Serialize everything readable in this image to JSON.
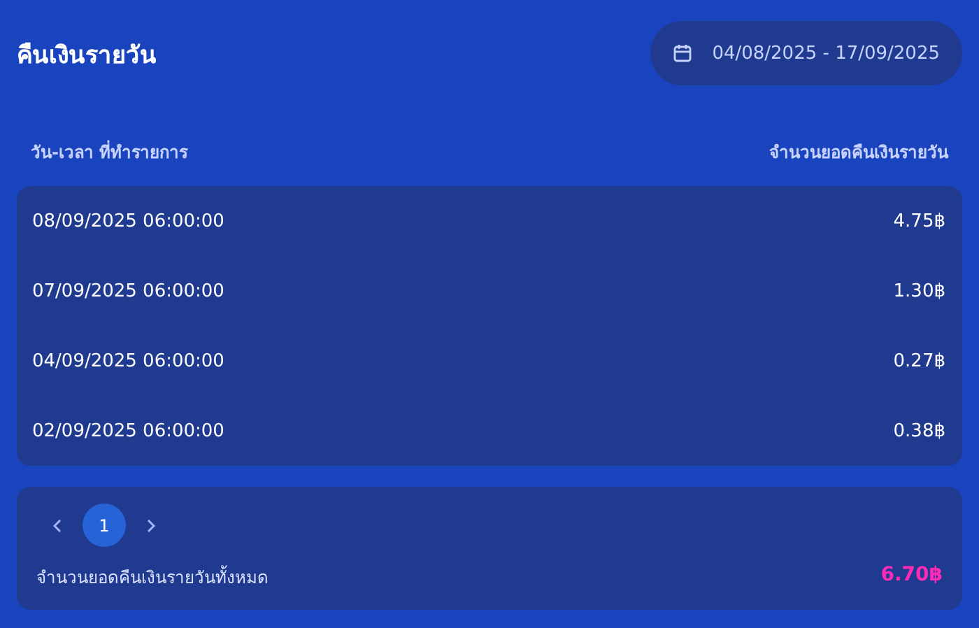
{
  "title": "คืนเงินรายวัน",
  "date_range": "04/08/2025 - 17/09/2025",
  "table": {
    "columns": [
      "วัน-เวลา ที่ทำรายการ",
      "จำนวนยอดคืนเงินรายวัน"
    ],
    "rows": [
      {
        "datetime": "08/09/2025 06:00:00",
        "amount": "4.75฿"
      },
      {
        "datetime": "07/09/2025 06:00:00",
        "amount": "1.30฿"
      },
      {
        "datetime": "04/09/2025 06:00:00",
        "amount": "0.27฿"
      },
      {
        "datetime": "02/09/2025 06:00:00",
        "amount": "0.38฿"
      }
    ]
  },
  "pagination": {
    "pages": [
      {
        "label": "1",
        "selected": true
      }
    ]
  },
  "total": {
    "label": "จำนวนยอดคืนเงินรายวันทั้งหมด",
    "value": "6.70฿"
  }
}
